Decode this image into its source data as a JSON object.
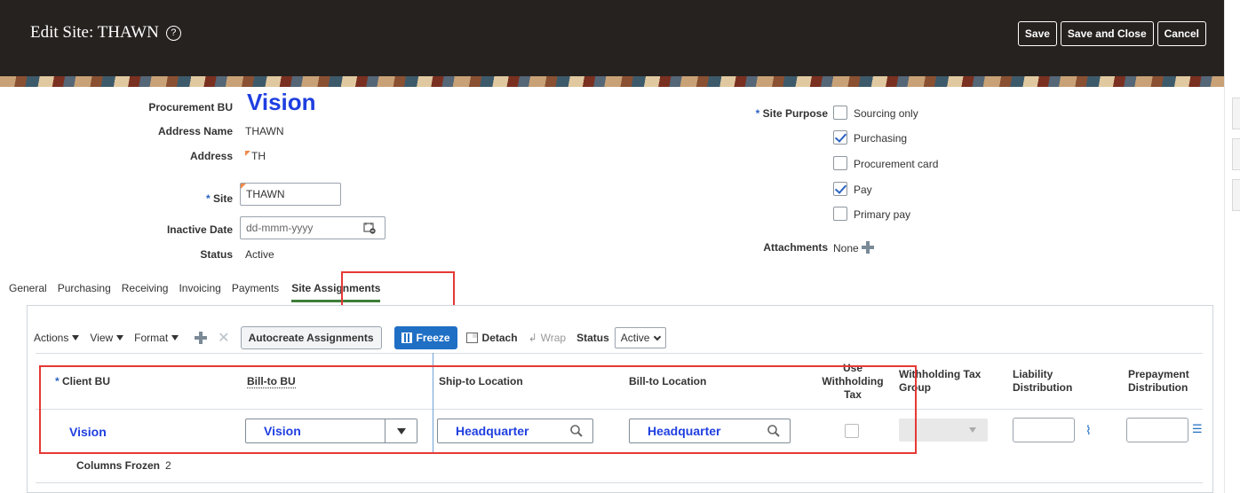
{
  "header": {
    "title": "Edit Site: THAWN",
    "help_icon": "?",
    "buttons": {
      "save": "Save",
      "save_close": "Save and Close",
      "cancel": "Cancel"
    }
  },
  "form": {
    "procurement_bu_label": "Procurement BU",
    "procurement_bu_value": "Vision",
    "address_name_label": "Address Name",
    "address_name_value": "THAWN",
    "address_label": "Address",
    "address_value": "TH",
    "site_label": "Site",
    "site_value": "THAWN",
    "inactive_date_label": "Inactive Date",
    "inactive_date_placeholder": "dd-mmm-yyyy",
    "status_label": "Status",
    "status_value": "Active",
    "required_marker": "*",
    "site_purpose_label": "Site Purpose",
    "site_purposes": [
      {
        "label": "Sourcing only",
        "checked": false
      },
      {
        "label": "Purchasing",
        "checked": true
      },
      {
        "label": "Procurement card",
        "checked": false
      },
      {
        "label": "Pay",
        "checked": true
      },
      {
        "label": "Primary pay",
        "checked": false
      }
    ],
    "attachments_label": "Attachments",
    "attachments_value": "None"
  },
  "tabs": [
    "General",
    "Purchasing",
    "Receiving",
    "Invoicing",
    "Payments",
    "Site Assignments"
  ],
  "active_tab": "Site Assignments",
  "toolbar": {
    "actions": "Actions",
    "view": "View",
    "format": "Format",
    "autocreate": "Autocreate Assignments",
    "freeze": "Freeze",
    "detach": "Detach",
    "wrap": "Wrap",
    "status_label": "Status",
    "status_value": "Active"
  },
  "table": {
    "headers": {
      "client_bu": "Client BU",
      "bill_to_bu": "Bill-to BU",
      "ship_to_location": "Ship-to Location",
      "bill_to_location": "Bill-to Location",
      "use_withholding_tax": "Use Withholding Tax",
      "withholding_tax_group": "Withholding Tax Group",
      "liability_distribution": "Liability Distribution",
      "prepayment_distribution": "Prepayment Distribution"
    },
    "row": {
      "client_bu": "Vision",
      "bill_to_bu": "Vision",
      "ship_to_location": "Headquarter",
      "bill_to_location": "Headquarter",
      "use_withholding_tax": false
    },
    "columns_frozen_label": "Columns Frozen",
    "columns_frozen_value": "2"
  },
  "colors": {
    "accent": "#1f6fc5",
    "link": "#1f3fe0",
    "highlight": "#e53935",
    "header_bg": "#262220"
  }
}
